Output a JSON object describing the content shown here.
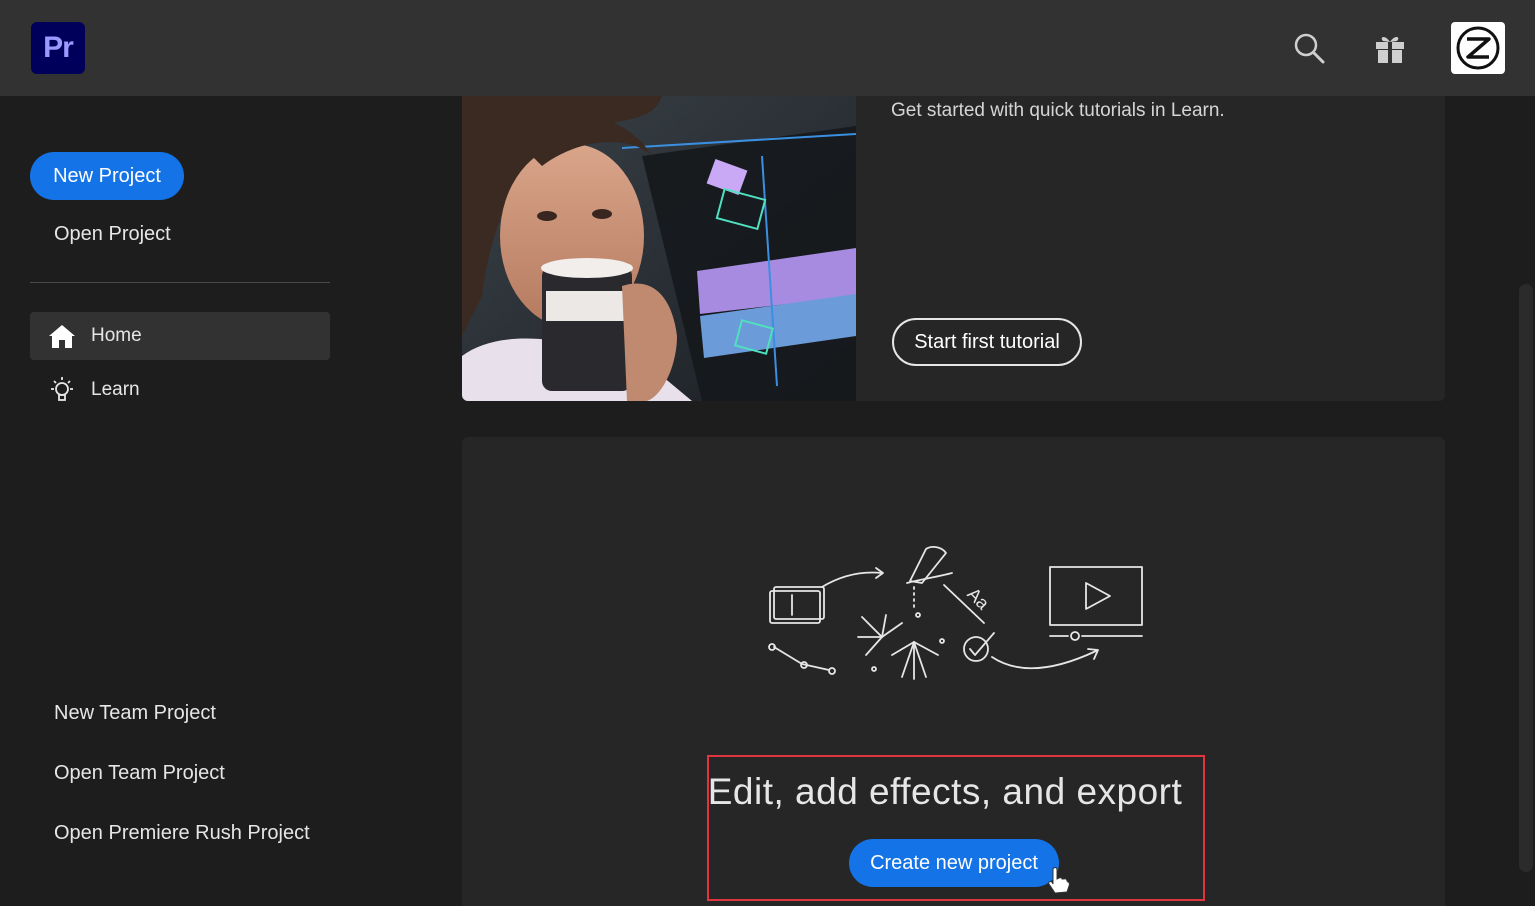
{
  "app": {
    "logo_text": "Pr"
  },
  "topbar": {
    "icons": [
      "search-icon",
      "gift-icon"
    ]
  },
  "sidebar": {
    "new_project_label": "New Project",
    "open_project_label": "Open Project",
    "nav": [
      {
        "label": "Home",
        "icon": "home-icon",
        "active": true
      },
      {
        "label": "Learn",
        "icon": "lightbulb-icon",
        "active": false
      }
    ],
    "bottom_links": [
      "New Team Project",
      "Open Team Project",
      "Open Premiere Rush Project"
    ]
  },
  "learn_card": {
    "text": "Get started with quick tutorials in Learn.",
    "button_label": "Start first tutorial"
  },
  "create_card": {
    "title": "Edit, add effects, and export",
    "button_label": "Create new project"
  },
  "colors": {
    "accent": "#1473e6",
    "highlight_border": "#e0343e",
    "logo_bg": "#00005b"
  }
}
